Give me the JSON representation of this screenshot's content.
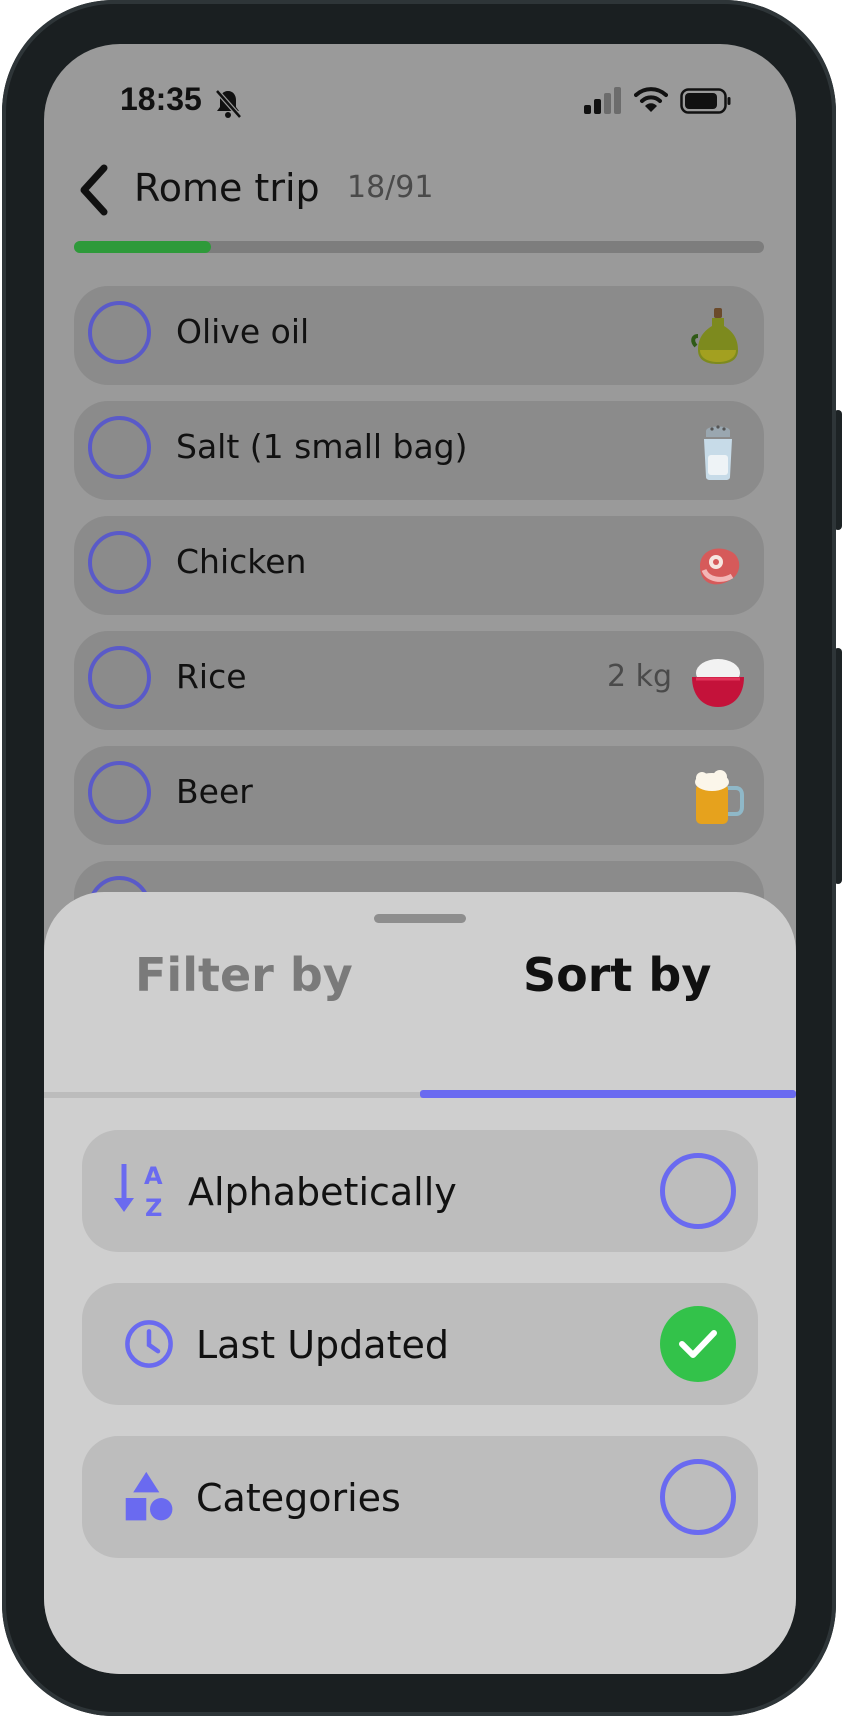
{
  "status_bar": {
    "time": "18:35"
  },
  "header": {
    "title": "Rome trip",
    "count": "18/91",
    "progress_fraction": 0.198
  },
  "list": [
    {
      "name": "Olive oil",
      "quantity": "",
      "icon": "olive-oil-icon"
    },
    {
      "name": "Salt (1 small bag)",
      "quantity": "",
      "icon": "salt-shaker-icon"
    },
    {
      "name": "Chicken",
      "quantity": "",
      "icon": "meat-icon"
    },
    {
      "name": "Rice",
      "quantity": "2 kg",
      "icon": "rice-bowl-icon"
    },
    {
      "name": "Beer",
      "quantity": "",
      "icon": "beer-mug-icon"
    }
  ],
  "sheet": {
    "tabs": [
      {
        "label": "Filter by",
        "active": false
      },
      {
        "label": "Sort by",
        "active": true
      }
    ],
    "options": [
      {
        "label": "Alphabetically",
        "icon": "sort-alpha-icon",
        "selected": false
      },
      {
        "label": "Last Updated",
        "icon": "clock-icon",
        "selected": true
      },
      {
        "label": "Categories",
        "icon": "shapes-icon",
        "selected": false
      }
    ]
  },
  "colors": {
    "accent": "#6a6af0",
    "success": "#33c24a",
    "progress": "#2e9a3a"
  }
}
